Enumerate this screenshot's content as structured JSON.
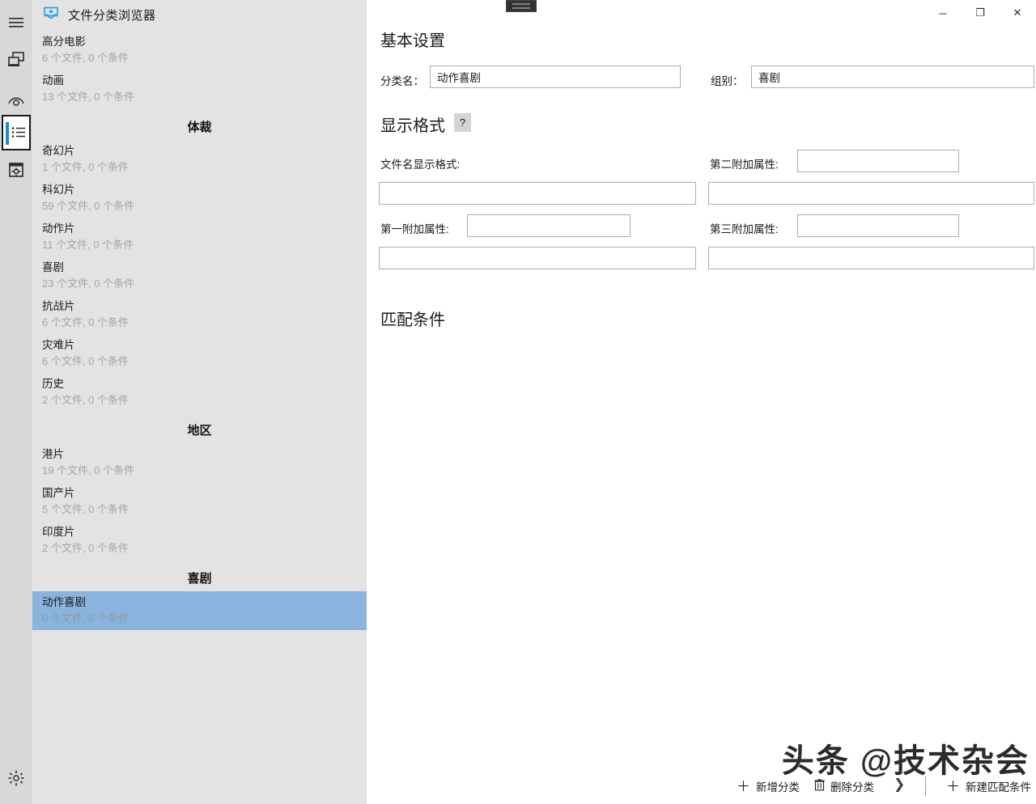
{
  "app": {
    "title": "文件分类浏览器",
    "icon": "inbox-tray-icon"
  },
  "window_controls": {
    "minimize": "─",
    "maximize": "❐",
    "close": "✕"
  },
  "rail": {
    "items": [
      {
        "icon": "hamburger-menu-icon",
        "selected": false
      },
      {
        "icon": "windows-stack-icon",
        "selected": false
      },
      {
        "icon": "eye-preview-icon",
        "selected": false
      },
      {
        "icon": "list-view-icon",
        "selected": true
      },
      {
        "icon": "settings-window-icon",
        "selected": false
      }
    ],
    "bottom": {
      "icon": "gear-icon"
    },
    "accent_color": "#1f8ad2"
  },
  "sidebar": {
    "background": "#e3e3e3",
    "selected_background": "#8ab4dd",
    "entries": [
      {
        "kind": "item",
        "name": "高分电影",
        "meta": "6 个文件,  0 个条件",
        "selected": false
      },
      {
        "kind": "item",
        "name": "动画",
        "meta": "13 个文件,  0 个条件",
        "selected": false
      },
      {
        "kind": "group",
        "name": "体裁"
      },
      {
        "kind": "item",
        "name": "奇幻片",
        "meta": "1 个文件,  0 个条件",
        "selected": false
      },
      {
        "kind": "item",
        "name": "科幻片",
        "meta": "59 个文件,  0 个条件",
        "selected": false
      },
      {
        "kind": "item",
        "name": "动作片",
        "meta": "11 个文件,  0 个条件",
        "selected": false
      },
      {
        "kind": "item",
        "name": "喜剧",
        "meta": "23 个文件,  0 个条件",
        "selected": false
      },
      {
        "kind": "item",
        "name": "抗战片",
        "meta": "6 个文件,  0 个条件",
        "selected": false
      },
      {
        "kind": "item",
        "name": "灾难片",
        "meta": "6 个文件,  0 个条件",
        "selected": false
      },
      {
        "kind": "item",
        "name": "历史",
        "meta": "2 个文件,  0 个条件",
        "selected": false
      },
      {
        "kind": "group",
        "name": "地区"
      },
      {
        "kind": "item",
        "name": "港片",
        "meta": "19 个文件,  0 个条件",
        "selected": false
      },
      {
        "kind": "item",
        "name": "国产片",
        "meta": "5 个文件,  0 个条件",
        "selected": false
      },
      {
        "kind": "item",
        "name": "印度片",
        "meta": "2 个文件,  0 个条件",
        "selected": false
      },
      {
        "kind": "group",
        "name": "喜剧"
      },
      {
        "kind": "item",
        "name": "动作喜剧",
        "meta": "0 个文件,  0 个条件",
        "selected": true
      }
    ]
  },
  "basic": {
    "heading": "基本设置",
    "category_label": "分类名：",
    "category_value": "动作喜剧",
    "group_label": "组别：",
    "group_value": "喜剧"
  },
  "format": {
    "heading": "显示格式",
    "help": "?",
    "filename_label": "文件名显示格式:",
    "filename_value": "",
    "attr1_label": "第一附加属性:",
    "attr1_value": "",
    "attr1_pattern": "",
    "attr2_label": "第二附加属性:",
    "attr2_value": "",
    "attr2_pattern": "",
    "attr3_label": "第三附加属性:",
    "attr3_value": "",
    "attr3_pattern": ""
  },
  "conditions": {
    "heading": "匹配条件"
  },
  "toolbar": {
    "add_category": "新增分类",
    "delete_category": "删除分类",
    "new_condition": "新建匹配条件",
    "add_icon": "plus-icon",
    "delete_icon": "trash-icon",
    "expand_icon": "chevron-right-icon"
  },
  "watermark": {
    "text": "头条 @技术杂会"
  }
}
